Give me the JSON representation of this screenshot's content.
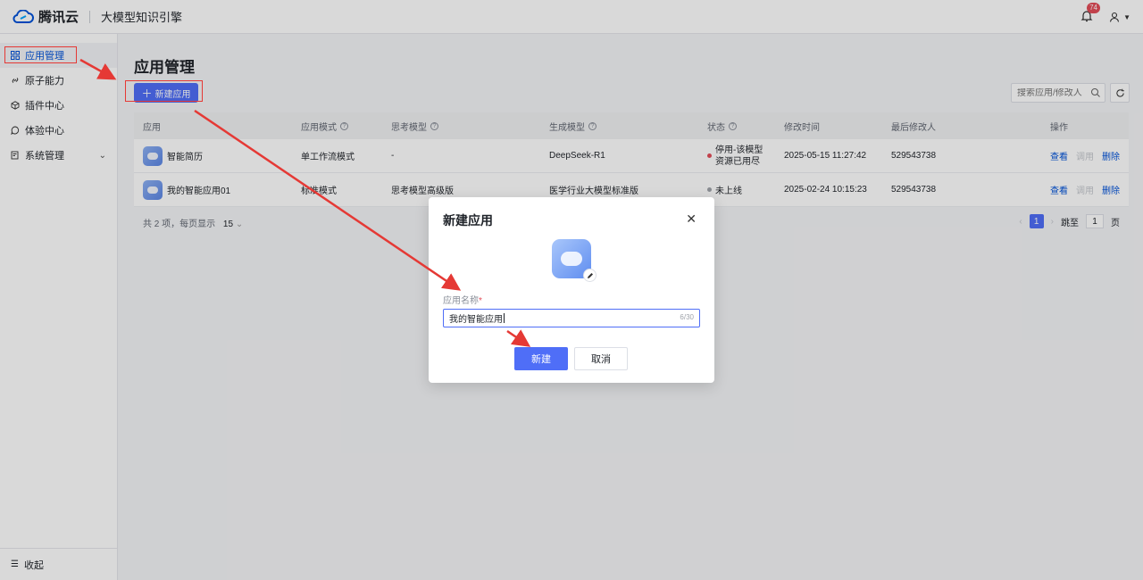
{
  "topbar": {
    "brand": "腾讯云",
    "product": "大模型知识引擎",
    "notification_count": "74"
  },
  "sidebar": {
    "items": [
      {
        "label": "应用管理",
        "icon": "grid-icon",
        "active": true
      },
      {
        "label": "原子能力",
        "icon": "link-icon"
      },
      {
        "label": "插件中心",
        "icon": "cube-icon"
      },
      {
        "label": "体验中心",
        "icon": "chat-icon"
      },
      {
        "label": "系统管理",
        "icon": "doc-settings-icon",
        "expandable": true
      }
    ],
    "collapse_label": "收起"
  },
  "main": {
    "title": "应用管理",
    "new_button": "新建应用",
    "search_placeholder": "搜索应用/修改人",
    "table": {
      "headers": {
        "app": "应用",
        "mode": "应用模式",
        "thinking": "思考模型",
        "gen": "生成模型",
        "status": "状态",
        "mtime": "修改时间",
        "modifier": "最后修改人",
        "ops": "操作"
      },
      "rows": [
        {
          "name": "智能简历",
          "mode": "单工作流模式",
          "thinking": "-",
          "gen": "DeepSeek-R1",
          "status_line1": "停用-该模型",
          "status_line2": "资源已用尽",
          "status_color": "red",
          "mtime": "2025-05-15 11:27:42",
          "modifier": "529543738"
        },
        {
          "name": "我的智能应用01",
          "mode": "标准模式",
          "thinking": "思考模型高级版",
          "gen": "医学行业大模型标准版",
          "status_line1": "未上线",
          "status_line2": "",
          "status_color": "gray",
          "mtime": "2025-02-24 10:15:23",
          "modifier": "529543738"
        }
      ],
      "ops": {
        "view": "查看",
        "use": "调用",
        "delete": "删除"
      }
    },
    "pagination": {
      "summary": "共 2 项，每页显示",
      "page_size": "15",
      "current_page": "1",
      "jump_label": "跳至",
      "jump_value": "1",
      "page_unit": "页"
    }
  },
  "modal": {
    "title": "新建应用",
    "field_label": "应用名称",
    "required_mark": "*",
    "input_value": "我的智能应用",
    "char_count": "6/30",
    "create_button": "新建",
    "cancel_button": "取消"
  },
  "colors": {
    "primary": "#4f6ef7",
    "annotation": "#e53935",
    "status_red": "#e34d59"
  }
}
